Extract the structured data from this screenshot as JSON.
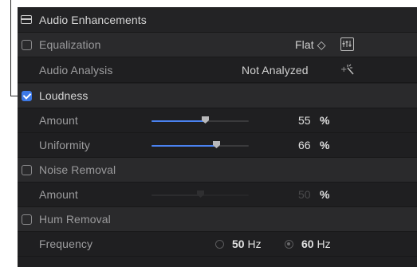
{
  "header": {
    "title": "Audio Enhancements"
  },
  "equalization": {
    "label": "Equalization",
    "checked": false,
    "preset": "Flat ◇"
  },
  "audio_analysis": {
    "label": "Audio Analysis",
    "status": "Not Analyzed"
  },
  "loudness": {
    "label": "Loudness",
    "checked": true,
    "amount": {
      "label": "Amount",
      "value": "55",
      "unit": "%",
      "fraction": 0.55
    },
    "uniformity": {
      "label": "Uniformity",
      "value": "66",
      "unit": "%",
      "fraction": 0.66
    }
  },
  "noise_removal": {
    "label": "Noise Removal",
    "checked": false,
    "amount": {
      "label": "Amount",
      "value": "50",
      "unit": "%",
      "fraction": 0.5
    }
  },
  "hum_removal": {
    "label": "Hum Removal",
    "checked": false,
    "frequency": {
      "label": "Frequency",
      "options": [
        {
          "value": "50",
          "unit": "Hz",
          "selected": false
        },
        {
          "value": "60",
          "unit": "Hz",
          "selected": true
        }
      ]
    }
  },
  "colors": {
    "accent": "#3d79e6",
    "panel": "#1f1f21",
    "section": "#2a2a2c"
  }
}
